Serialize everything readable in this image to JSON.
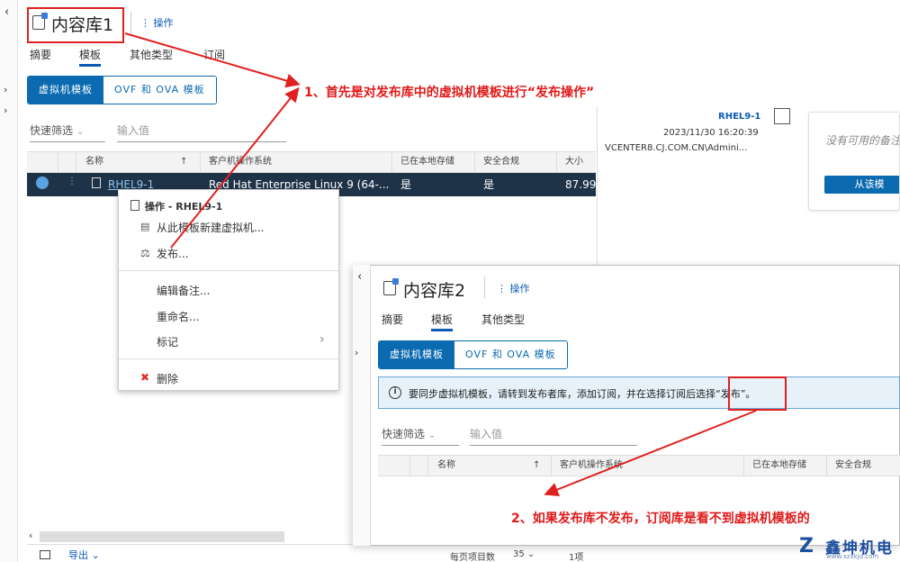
{
  "lib1": {
    "title": "内容库1",
    "actions_label": "操作",
    "tabs": [
      "摘要",
      "模板",
      "其他类型",
      "订阅"
    ],
    "seg": [
      "虚拟机模板",
      "OVF 和 OVA 模板"
    ],
    "filter_label": "快速筛选",
    "filter_placeholder": "输入值",
    "columns": [
      "名称",
      "客户机操作系统",
      "已在本地存储",
      "安全合规",
      "大小"
    ],
    "row": {
      "name": "RHEL9-1",
      "os": "Red Hat Enterprise Linux 9 (64-...",
      "stored": "是",
      "compliant": "是",
      "size": "87.99"
    },
    "footer": {
      "export_label": "导出",
      "page_size_label": "每页项目数",
      "page_size": "35",
      "count": "1项"
    }
  },
  "details": {
    "name": "RHEL9-1",
    "date": "2023/11/30 16:20:39",
    "host": "VCENTER8.CJ.COM.CN\\Admini...",
    "no_notes": "没有可用的备注",
    "button": "从该模"
  },
  "context_menu": {
    "header": "操作 - RHEL9-1",
    "items": [
      "从此模板新建虚拟机...",
      "发布...",
      "编辑备注...",
      "重命名...",
      "标记",
      "删除"
    ]
  },
  "lib2": {
    "title": "内容库2",
    "actions_label": "操作",
    "tabs": [
      "摘要",
      "模板",
      "其他类型"
    ],
    "seg": [
      "虚拟机模板",
      "OVF 和 OVA 模板"
    ],
    "info": "要同步虚拟机模板，请转到发布者库，添加订阅，并在选择订阅后选择“发布”。",
    "filter_label": "快速筛选",
    "filter_placeholder": "输入值",
    "columns": [
      "名称",
      "客户机操作系统",
      "已在本地存储",
      "安全合规"
    ]
  },
  "annotations": {
    "note1": "1、首先是对发布库中的虚拟机模板进行“发布操作”",
    "note2": "2、如果发布库不发布，订阅库是看不到虚拟机模板的"
  },
  "watermark": "鑫坤机电",
  "watermark_url": "www.xzxkjd.com",
  "colors": {
    "accent": "#0b6ab0",
    "annotation": "#e01818",
    "selected_row": "#1e3348"
  }
}
